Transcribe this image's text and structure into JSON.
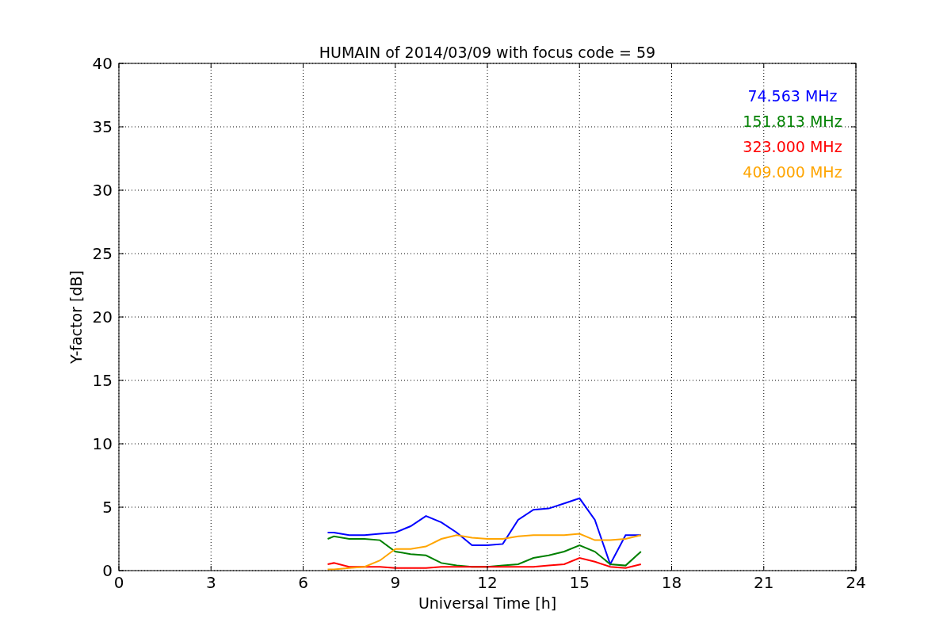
{
  "figure": {
    "chart_data": {
      "type": "line",
      "title": "HUMAIN of 2014/03/09 with focus code = 59",
      "xlabel": "Universal Time [h]",
      "ylabel": "Y-factor [dB]",
      "x": [
        6.8,
        7,
        7.5,
        8,
        8.5,
        9,
        9.5,
        10,
        10.5,
        11,
        11.5,
        12,
        12.5,
        13,
        13.5,
        14,
        14.5,
        15,
        15.5,
        16,
        16.5,
        17
      ],
      "series": [
        {
          "name": "74.563 MHz",
          "color": "#0000ff",
          "values": [
            3,
            3,
            2.8,
            2.8,
            2.9,
            3,
            3.5,
            4.3,
            3.8,
            3.0,
            2.0,
            2.0,
            2.1,
            4.0,
            4.8,
            4.9,
            5.3,
            5.7,
            4.0,
            0.5,
            2.8,
            2.8
          ]
        },
        {
          "name": "151.813 MHz",
          "color": "#008000",
          "values": [
            2.5,
            2.7,
            2.5,
            2.5,
            2.4,
            1.5,
            1.3,
            1.2,
            0.6,
            0.4,
            0.3,
            0.3,
            0.4,
            0.5,
            1.0,
            1.2,
            1.5,
            2.0,
            1.5,
            0.5,
            0.4,
            1.5
          ]
        },
        {
          "name": "323.000 MHz",
          "color": "#ff0000",
          "values": [
            0.5,
            0.6,
            0.3,
            0.3,
            0.3,
            0.2,
            0.2,
            0.2,
            0.3,
            0.3,
            0.3,
            0.3,
            0.3,
            0.3,
            0.3,
            0.4,
            0.5,
            1.0,
            0.7,
            0.3,
            0.2,
            0.5
          ]
        },
        {
          "name": "409.000 MHz",
          "color": "#ffa500",
          "values": [
            0.1,
            0.1,
            0.2,
            0.3,
            0.8,
            1.7,
            1.7,
            1.9,
            2.5,
            2.8,
            2.6,
            2.5,
            2.5,
            2.7,
            2.8,
            2.8,
            2.8,
            2.9,
            2.4,
            2.4,
            2.5,
            2.8
          ]
        }
      ],
      "xlim": [
        0,
        24
      ],
      "ylim": [
        0,
        40
      ],
      "xticks": [
        0,
        3,
        6,
        9,
        12,
        15,
        18,
        21,
        24
      ],
      "yticks": [
        0,
        5,
        10,
        15,
        20,
        25,
        30,
        35,
        40
      ],
      "grid": true
    }
  }
}
